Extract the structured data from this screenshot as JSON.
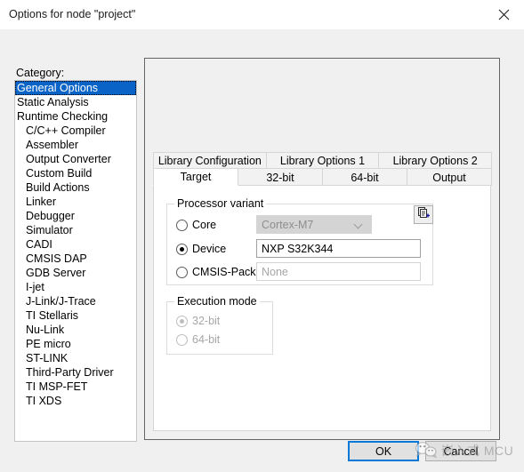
{
  "window": {
    "title": "Options for node \"project\"",
    "close_icon": "close-icon"
  },
  "sidebar": {
    "label": "Category:",
    "selected_index": 0,
    "items": [
      {
        "label": "General Options",
        "indent": false
      },
      {
        "label": "Static Analysis",
        "indent": false
      },
      {
        "label": "Runtime Checking",
        "indent": false
      },
      {
        "label": "C/C++ Compiler",
        "indent": true
      },
      {
        "label": "Assembler",
        "indent": true
      },
      {
        "label": "Output Converter",
        "indent": true
      },
      {
        "label": "Custom Build",
        "indent": true
      },
      {
        "label": "Build Actions",
        "indent": true
      },
      {
        "label": "Linker",
        "indent": true
      },
      {
        "label": "Debugger",
        "indent": true
      },
      {
        "label": "Simulator",
        "indent": true
      },
      {
        "label": "CADI",
        "indent": true
      },
      {
        "label": "CMSIS DAP",
        "indent": true
      },
      {
        "label": "GDB Server",
        "indent": true
      },
      {
        "label": "I-jet",
        "indent": true
      },
      {
        "label": "J-Link/J-Trace",
        "indent": true
      },
      {
        "label": "TI Stellaris",
        "indent": true
      },
      {
        "label": "Nu-Link",
        "indent": true
      },
      {
        "label": "PE micro",
        "indent": true
      },
      {
        "label": "ST-LINK",
        "indent": true
      },
      {
        "label": "Third-Party Driver",
        "indent": true
      },
      {
        "label": "TI MSP-FET",
        "indent": true
      },
      {
        "label": "TI XDS",
        "indent": true
      }
    ]
  },
  "tabs": {
    "top_row": [
      {
        "label": "Library Configuration",
        "active": false
      },
      {
        "label": "Library Options 1",
        "active": false
      },
      {
        "label": "Library Options 2",
        "active": false
      }
    ],
    "bottom_row": [
      {
        "label": "Target",
        "active": true
      },
      {
        "label": "32-bit",
        "active": false
      },
      {
        "label": "64-bit",
        "active": false
      },
      {
        "label": "Output",
        "active": false
      }
    ]
  },
  "processor_variant": {
    "title": "Processor variant",
    "core": {
      "radio_label": "Core",
      "selected": false,
      "value": "Cortex-M7",
      "disabled": true,
      "dropdown_icon": "chevron-down-icon"
    },
    "device": {
      "radio_label": "Device",
      "selected": true,
      "value": "NXP S32K344",
      "pick_icon": "device-select-icon"
    },
    "cmsis_pack": {
      "radio_label": "CMSIS-Pack",
      "selected": false,
      "placeholder": "None",
      "value": "None"
    }
  },
  "execution_mode": {
    "title": "Execution mode",
    "disabled": true,
    "options": [
      {
        "label": "32-bit",
        "selected": true
      },
      {
        "label": "64-bit",
        "selected": false
      }
    ]
  },
  "footer": {
    "ok_label": "OK",
    "cancel_label": "Cancel"
  },
  "watermark": {
    "text": "嵌入式 MCU",
    "icon": "wechat-icon"
  },
  "colors": {
    "accent": "#0a64c8",
    "focus": "#0078d7",
    "dialog_bg": "#f0f0f0",
    "panel_bg": "#ffffff"
  }
}
